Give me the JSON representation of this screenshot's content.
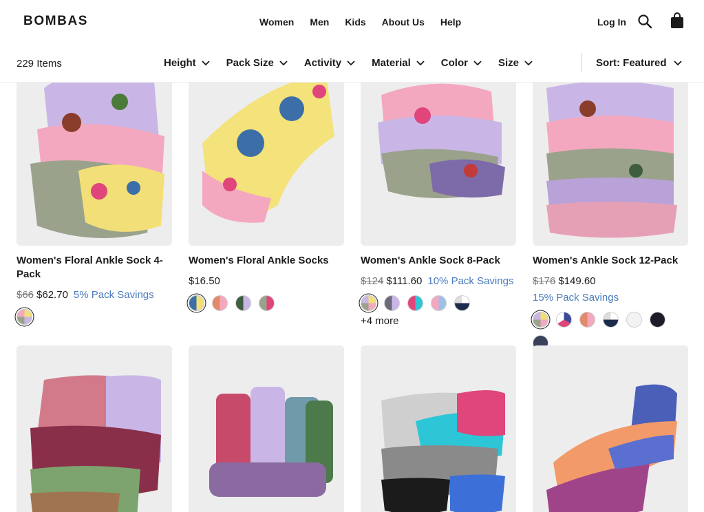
{
  "brand": "BOMBAS",
  "nav": {
    "women": "Women",
    "men": "Men",
    "kids": "Kids",
    "about": "About Us",
    "help": "Help",
    "login": "Log In"
  },
  "listing": {
    "count": "229 Items"
  },
  "filters": {
    "height": "Height",
    "pack_size": "Pack Size",
    "activity": "Activity",
    "material": "Material",
    "color": "Color",
    "size": "Size",
    "sort": "Sort: Featured"
  },
  "products": [
    {
      "title": "Women's Floral Ankle Sock 4-Pack",
      "price_old": "$66",
      "price": "$62.70",
      "savings": "5% Pack Savings"
    },
    {
      "title": "Women's Floral Ankle Socks",
      "price": "$16.50"
    },
    {
      "title": "Women's Ankle Sock 8-Pack",
      "price_old": "$124",
      "price": "$111.60",
      "savings": "10% Pack Savings",
      "more": "+4 more"
    },
    {
      "title": "Women's Ankle Sock 12-Pack",
      "price_old": "$176",
      "price": "$149.60",
      "savings": "15% Pack Savings"
    }
  ],
  "colors": {
    "accent": "#4a7bbd",
    "text": "#1b1b1b",
    "card_bg": "#ededed"
  }
}
